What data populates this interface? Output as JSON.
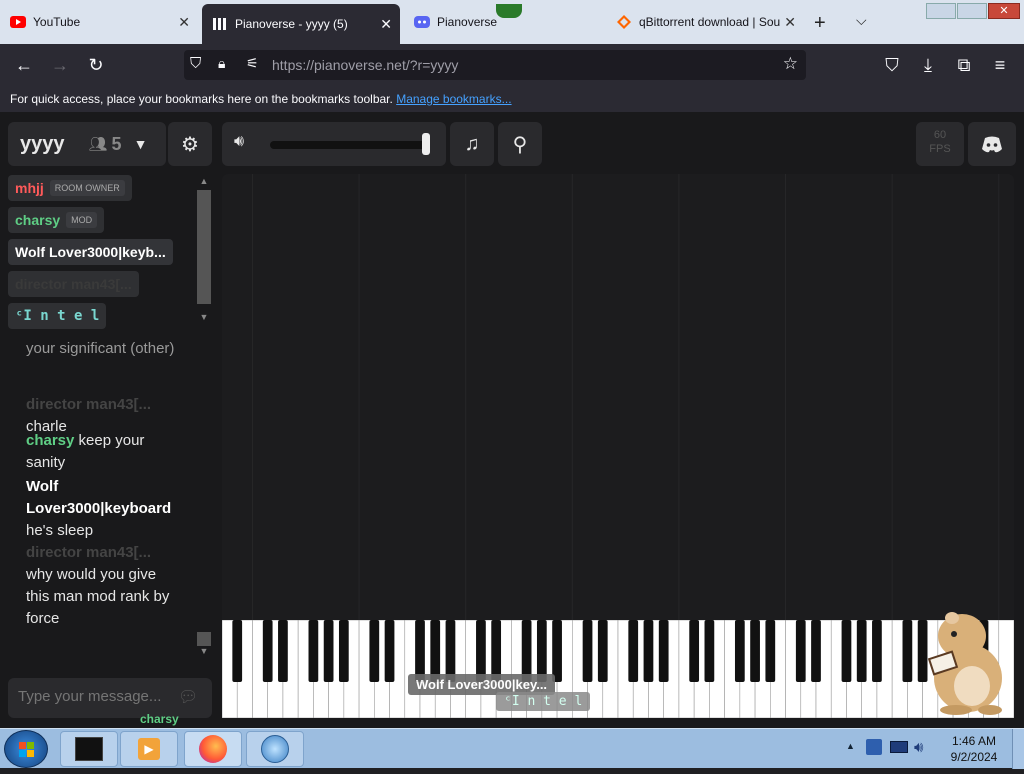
{
  "browser": {
    "tabs": [
      {
        "title": "YouTube",
        "active": false
      },
      {
        "title": "Pianoverse - yyyy (5)",
        "active": true
      },
      {
        "title": "Pianoverse",
        "active": false
      },
      {
        "title": "qBittorrent download | Sou",
        "active": false
      }
    ],
    "url": "https://pianoverse.net/?r=yyyy",
    "bookmarks_text": "For quick access, place your bookmarks here on the bookmarks toolbar.",
    "bookmarks_link": "Manage bookmarks..."
  },
  "room": {
    "name": "yyyy",
    "user_count": "5",
    "fps_value": "60",
    "fps_label": "FPS"
  },
  "users": [
    {
      "name": "mhjj",
      "badge": "ROOM OWNER",
      "color": "#ff5a5a"
    },
    {
      "name": "charsy",
      "badge": "MOD",
      "color": "#5fce85"
    },
    {
      "name": "Wolf Lover3000|keyb...",
      "badge": "",
      "color": "#ffffff"
    },
    {
      "name": "director man43[...",
      "badge": "",
      "color": "#3a3a3a"
    },
    {
      "name": "ᶜI n t e l",
      "badge": "",
      "color": "#7ad7d0"
    }
  ],
  "chat": {
    "line1": "your significant (other)",
    "msg2_user": "director man43[...",
    "msg2_text": "charle",
    "msg3_user": "charsy",
    "msg3_text": "keep your sanity",
    "msg4_user": "Wolf Lover3000|keyboard",
    "msg4_text": "he's sleep",
    "msg5_user": "director man43[...",
    "msg5_text": "why would you give this man mod rank by force",
    "input_placeholder": "Type your message...",
    "typing_user": "charsy"
  },
  "piano_overlays": {
    "label1": "Wolf Lover3000|key...",
    "label2": "ᶜI n t e l"
  },
  "taskbar": {
    "time": "1:46 AM",
    "date": "9/2/2024"
  },
  "colors": {
    "accent_link": "#45a1ff",
    "owner_red": "#ff5a5a",
    "mod_green": "#5fce85"
  },
  "icons": {
    "volume": "speaker-icon",
    "music": "music-note-icon",
    "usb": "usb-icon",
    "settings": "gear-icon",
    "discord": "discord-icon"
  }
}
